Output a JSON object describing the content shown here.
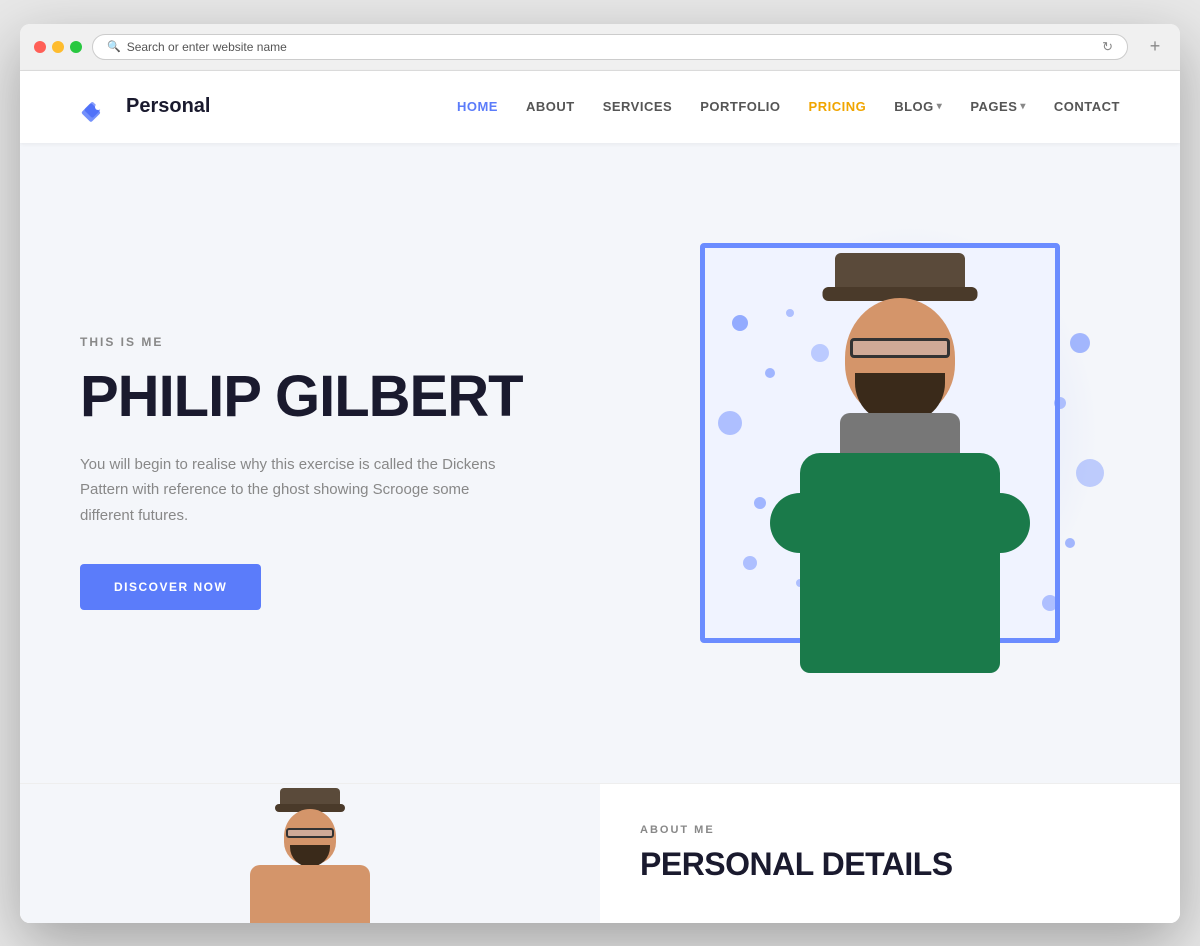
{
  "browser": {
    "address_placeholder": "Search or enter website name"
  },
  "navbar": {
    "logo_text": "Personal",
    "nav_items": [
      {
        "label": "HOME",
        "active": true
      },
      {
        "label": "ABOUT",
        "active": false
      },
      {
        "label": "SERVICES",
        "active": false
      },
      {
        "label": "PORTFOLIO",
        "active": false
      },
      {
        "label": "PRICING",
        "active": false,
        "highlight": true
      },
      {
        "label": "BLOG",
        "active": false,
        "has_arrow": true
      },
      {
        "label": "PAGES",
        "active": false,
        "has_arrow": true
      },
      {
        "label": "CONTACT",
        "active": false
      }
    ]
  },
  "hero": {
    "subtitle": "THIS IS ME",
    "title": "PHILIP GILBERT",
    "description": "You will begin to realise why this exercise is called the Dickens Pattern with reference to the ghost showing Scrooge some different futures.",
    "cta_button": "DISCOVER NOW"
  },
  "about_teaser": {
    "label": "ABOUT ME",
    "title": "PERSONAL DETAILS"
  },
  "colors": {
    "accent": "#5b7cfa",
    "highlight": "#f0a500",
    "dark": "#1a1a2e",
    "muted": "#888888"
  }
}
